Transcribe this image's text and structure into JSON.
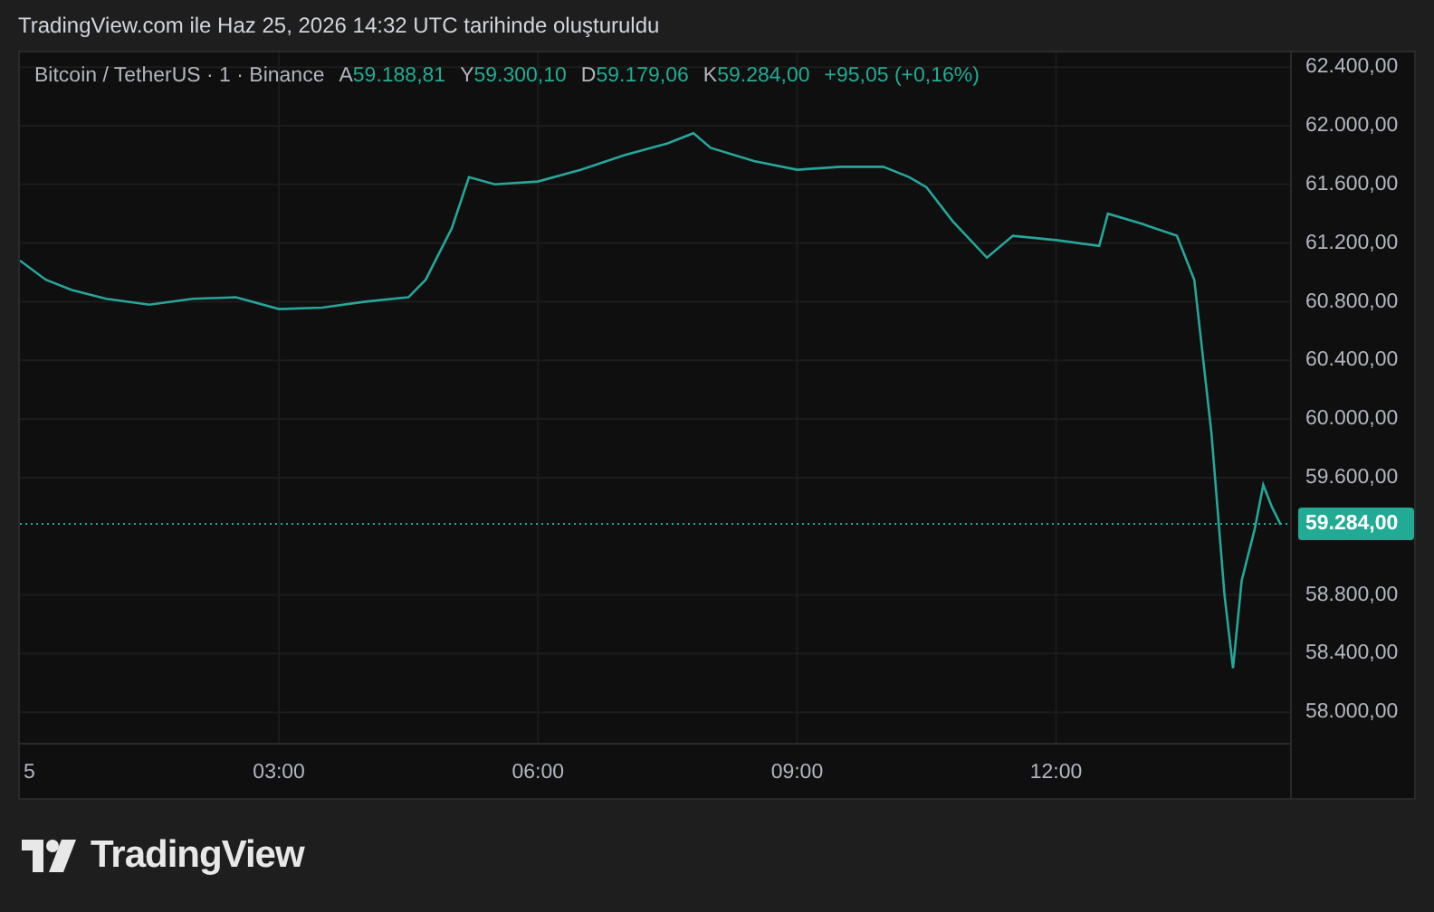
{
  "header": {
    "title": "TradingView.com ile Haz 25, 2026 14:32 UTC tarihinde oluşturuldu"
  },
  "legend": {
    "symbol": "Bitcoin / TetherUS · 1 · Binance",
    "values": [
      {
        "label": "A",
        "value": "59.188,81"
      },
      {
        "label": "Y",
        "value": "59.300,10"
      },
      {
        "label": "D",
        "value": "59.179,06"
      },
      {
        "label": "K",
        "value": "59.284,00"
      }
    ],
    "change": "+95,05 (+0,16%)"
  },
  "time_axis_edge_label": "5",
  "chart_data": {
    "type": "line",
    "xlim": [
      0,
      14.72
    ],
    "ylim": [
      57785,
      62500
    ],
    "grid": true,
    "ref_lines": [
      {
        "axis": "y",
        "value": 59284,
        "label": "59.284,00",
        "color": "#22ab94"
      }
    ],
    "xticks": [
      {
        "value": 3,
        "label": "03:00"
      },
      {
        "value": 6,
        "label": "06:00"
      },
      {
        "value": 9,
        "label": "09:00"
      },
      {
        "value": 12,
        "label": "12:00"
      }
    ],
    "yticks": [
      {
        "value": 62400,
        "label": "62.400,00"
      },
      {
        "value": 62000,
        "label": "62.000,00"
      },
      {
        "value": 61600,
        "label": "61.600,00"
      },
      {
        "value": 61200,
        "label": "61.200,00"
      },
      {
        "value": 60800,
        "label": "60.800,00"
      },
      {
        "value": 60400,
        "label": "60.400,00"
      },
      {
        "value": 60000,
        "label": "60.000,00"
      },
      {
        "value": 59600,
        "label": "59.600,00"
      },
      {
        "value": 58800,
        "label": "58.800,00"
      },
      {
        "value": 58400,
        "label": "58.400,00"
      },
      {
        "value": 58000,
        "label": "58.000,00"
      }
    ],
    "x": [
      0,
      0.3,
      0.6,
      1,
      1.5,
      2,
      2.5,
      3,
      3.5,
      4,
      4.5,
      4.7,
      5,
      5.2,
      5.5,
      6,
      6.5,
      7,
      7.5,
      7.8,
      8,
      8.5,
      9,
      9.5,
      10,
      10.3,
      10.5,
      10.8,
      11.2,
      11.5,
      12,
      12.5,
      12.6,
      13,
      13.4,
      13.6,
      13.8,
      13.95,
      14.05,
      14.15,
      14.3,
      14.4,
      14.5,
      14.6
    ],
    "series": [
      {
        "color": "#26a69a",
        "values": [
          61080,
          60950,
          60880,
          60820,
          60780,
          60820,
          60830,
          60750,
          60760,
          60800,
          60830,
          60950,
          61300,
          61650,
          61600,
          61620,
          61700,
          61800,
          61880,
          61950,
          61850,
          61760,
          61700,
          61720,
          61720,
          61650,
          61580,
          61350,
          61100,
          61250,
          61220,
          61180,
          61400,
          61330,
          61250,
          60950,
          59900,
          58800,
          58300,
          58900,
          59250,
          59550,
          59400,
          59280
        ]
      }
    ]
  },
  "footer": {
    "brand": "TradingView"
  }
}
